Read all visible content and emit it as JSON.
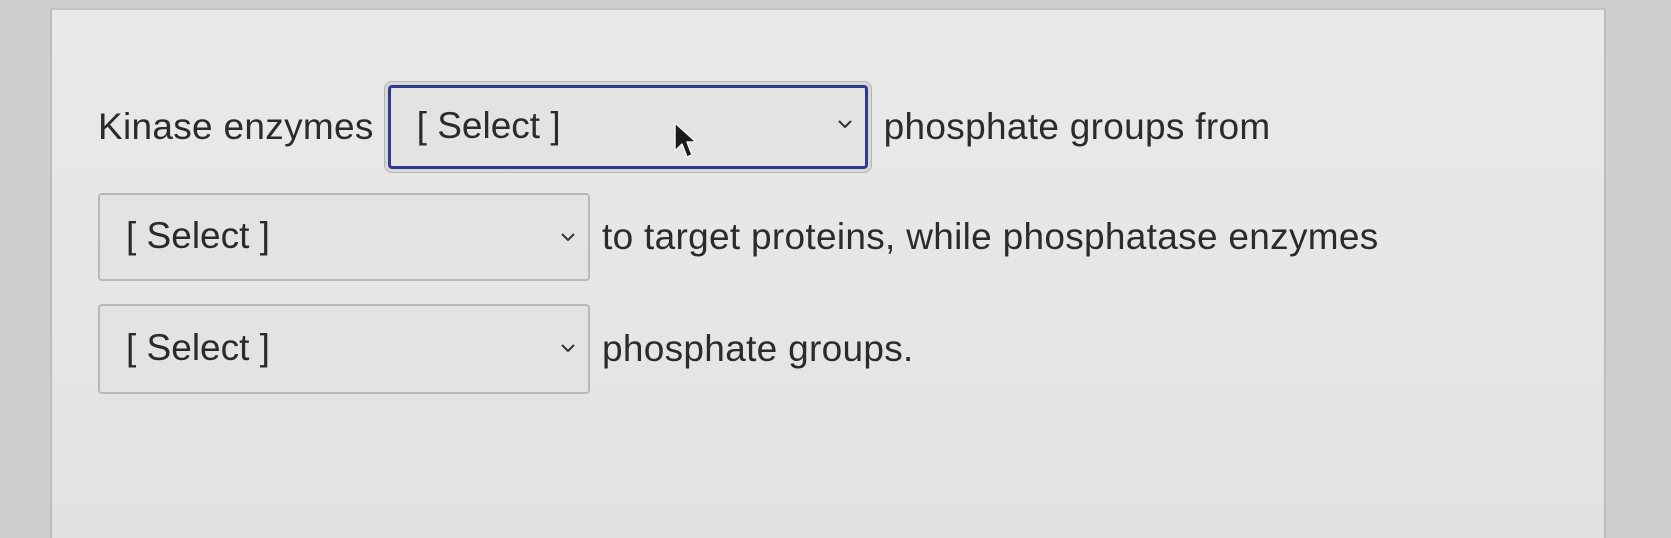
{
  "question": {
    "segments": {
      "kinase_prefix": "Kinase enzymes",
      "after_first": "phosphate groups from",
      "after_second": "to target proteins, while phosphatase enzymes",
      "after_third": "phosphate groups."
    },
    "dropdowns": [
      {
        "selected": "[ Select ]",
        "focused": true
      },
      {
        "selected": "[ Select ]",
        "focused": false
      },
      {
        "selected": "[ Select ]",
        "focused": false
      }
    ]
  },
  "icons": {
    "dropdown_chevron": "chevron-down-icon",
    "pointer": "mouse-pointer-icon"
  },
  "colors": {
    "focus_border": "#2d3b8c",
    "text": "#2b2b2b",
    "panel": "#e7e7e5"
  }
}
